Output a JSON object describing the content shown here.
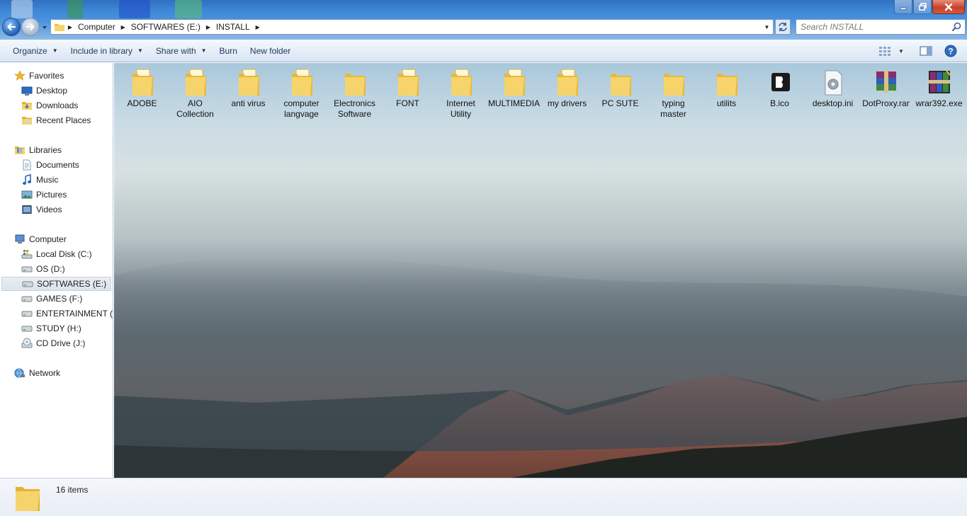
{
  "window": {
    "minimize_label": "minimize",
    "maximize_label": "restore",
    "close_label": "close"
  },
  "address": {
    "crumbs": [
      "Computer",
      "SOFTWARES (E:)",
      "INSTALL"
    ]
  },
  "search": {
    "placeholder": "Search INSTALL"
  },
  "toolbar": {
    "organize": "Organize",
    "include_in_library": "Include in library",
    "share_with": "Share with",
    "burn": "Burn",
    "new_folder": "New folder"
  },
  "sidebar": {
    "favorites": "Favorites",
    "desktop": "Desktop",
    "downloads": "Downloads",
    "recent_places": "Recent Places",
    "libraries": "Libraries",
    "documents": "Documents",
    "music": "Music",
    "pictures": "Pictures",
    "videos": "Videos",
    "computer": "Computer",
    "local_disk": "Local Disk (C:)",
    "os": "OS (D:)",
    "softwares": "SOFTWARES (E:)",
    "games": "GAMES (F:)",
    "entertainment": "ENTERTAINMENT (G:)",
    "study": "STUDY (H:)",
    "cd_drive": "CD Drive (J:)",
    "network": "Network"
  },
  "files": {
    "adobe": {
      "line1": "ADOBE",
      "line2": ""
    },
    "aio": {
      "line1": "AIO",
      "line2": "Collection"
    },
    "anti_virus": {
      "line1": "anti virus",
      "line2": ""
    },
    "computer_langvage": {
      "line1": "computer",
      "line2": "langvage"
    },
    "electronics": {
      "line1": "Electronics",
      "line2": "Software"
    },
    "font": {
      "line1": "FONT",
      "line2": ""
    },
    "internet": {
      "line1": "Internet",
      "line2": "Utility"
    },
    "multimedia": {
      "line1": "MULTIMEDIA",
      "line2": ""
    },
    "my_drivers": {
      "line1": "my drivers",
      "line2": ""
    },
    "pc_sute": {
      "line1": "PC SUTE",
      "line2": ""
    },
    "typing": {
      "line1": "typing",
      "line2": "master"
    },
    "utilits": {
      "line1": "utilits",
      "line2": ""
    },
    "b_ico": {
      "line1": "B.ico",
      "line2": ""
    },
    "desktop_ini": {
      "line1": "desktop.ini",
      "line2": ""
    },
    "dotproxy": {
      "line1": "DotProxy.rar",
      "line2": ""
    },
    "wrar": {
      "line1": "wrar392.exe",
      "line2": ""
    }
  },
  "status": {
    "item_count": "16 items"
  },
  "colors": {
    "titlebar": "#3d86d6",
    "folder_yellow": "#f3cc52",
    "selection": "#dde4ec",
    "nav_text": "#1e395b"
  }
}
